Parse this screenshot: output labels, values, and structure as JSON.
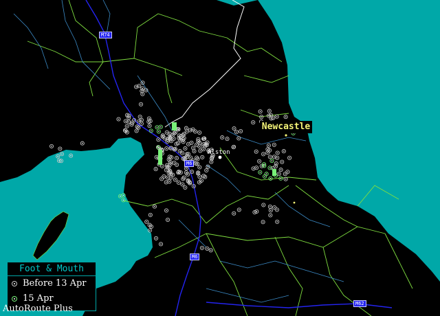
{
  "map": {
    "places": {
      "newcastle": "Newcastle",
      "alston": "Alston"
    },
    "roads": {
      "m74": "M74",
      "m6_north": "M6",
      "m6_south": "M6",
      "m62": "M62"
    }
  },
  "legend": {
    "title": "Foot & Mouth",
    "items": [
      {
        "label": "Before 13 Apr",
        "symbol": "grey-circle-icon"
      },
      {
        "label": "15 Apr",
        "symbol": "green-circle-icon"
      }
    ]
  },
  "branding": {
    "text": "AutoRoute Plus"
  },
  "colors": {
    "sea": "#00a8a8",
    "land": "#000000",
    "county_border": "#80e040",
    "national_border": "#ffffff",
    "river": "#3c8cc8",
    "motorway": "#2424f0",
    "case_before": "#c8c8c8",
    "case_new": "#78f078"
  }
}
